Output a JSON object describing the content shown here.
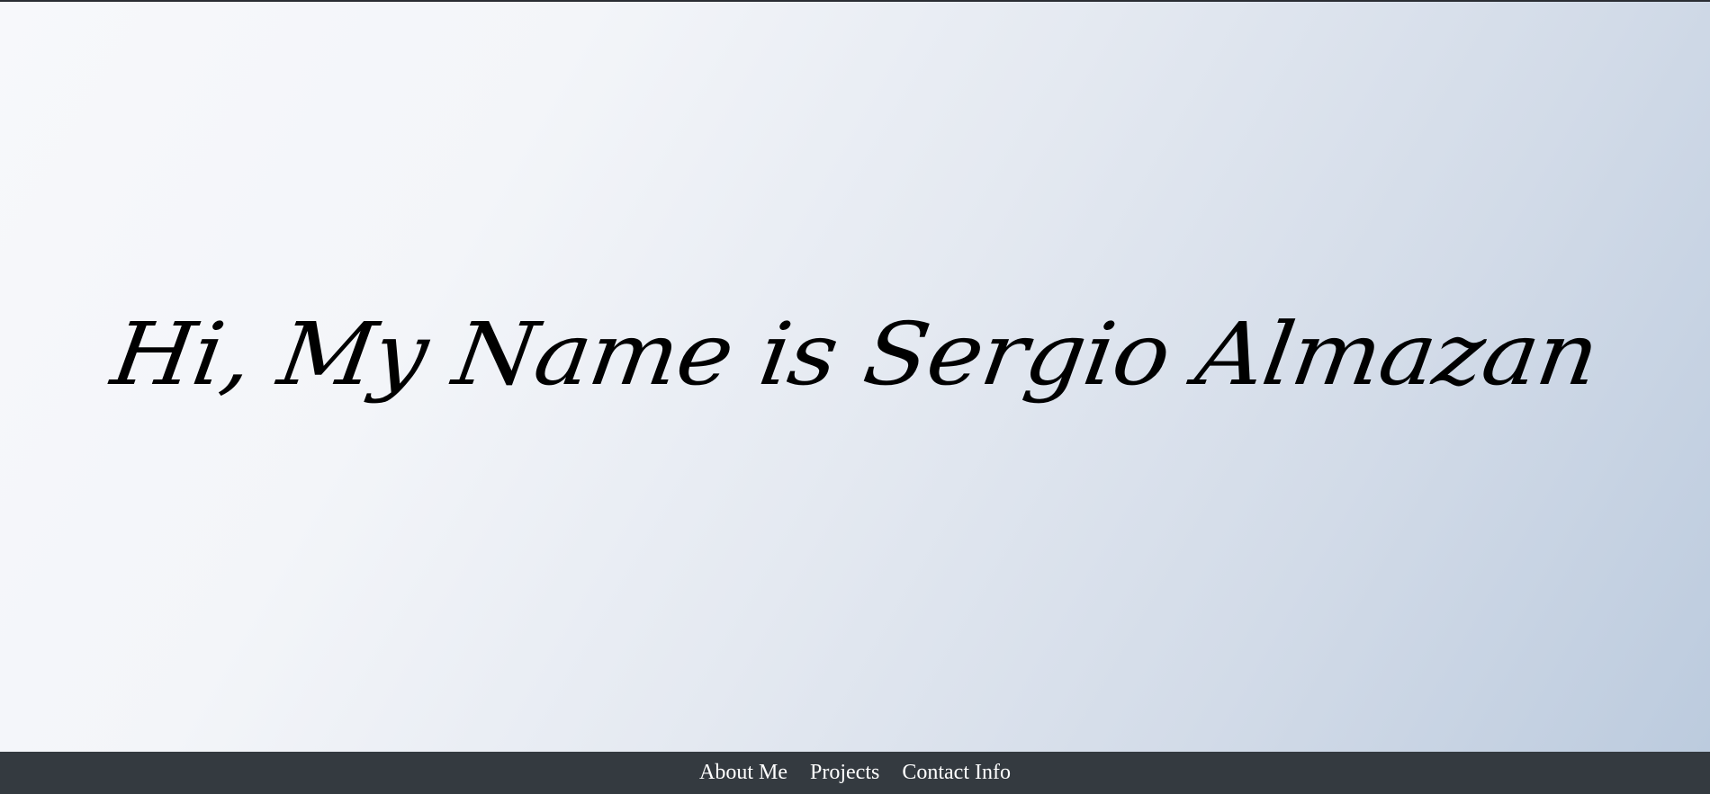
{
  "hero": {
    "greeting": "Hi, My Name is Sergio Almazan"
  },
  "nav": {
    "items": [
      {
        "label": "About Me"
      },
      {
        "label": "Projects"
      },
      {
        "label": "Contact Info"
      }
    ]
  },
  "colors": {
    "nav_background": "#343a40",
    "nav_text": "#ffffff",
    "greeting_text": "#000000",
    "hero_gradient_start": "#f7f8fb",
    "hero_gradient_end": "#bccbde"
  }
}
